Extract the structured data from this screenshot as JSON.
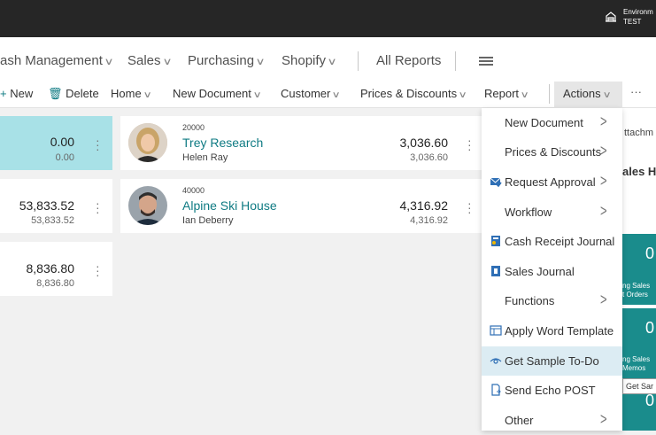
{
  "environment": {
    "line1": "Environm",
    "line2": "TEST"
  },
  "nav": {
    "cash_management": "ash Management",
    "sales": "Sales",
    "purchasing": "Purchasing",
    "shopify": "Shopify",
    "all_reports": "All Reports"
  },
  "actions": {
    "new": "New",
    "delete": "Delete",
    "home": "Home",
    "new_document": "New Document",
    "customer": "Customer",
    "prices_discounts": "Prices & Discounts",
    "report": "Report",
    "actions": "Actions",
    "more": "···"
  },
  "left_cards": [
    {
      "amount": "0.00",
      "sub": "0.00"
    },
    {
      "amount": "53,833.52",
      "sub": "53,833.52"
    },
    {
      "amount": "8,836.80",
      "sub": "8,836.80"
    }
  ],
  "customers": [
    {
      "no": "20000",
      "name": "Trey Research",
      "contact": "Helen Ray",
      "amount": "3,036.60",
      "sub": "3,036.60"
    },
    {
      "no": "40000",
      "name": "Alpine Ski House",
      "contact": "Ian Deberry",
      "amount": "4,316.92",
      "sub": "4,316.92"
    }
  ],
  "right_pane": {
    "attachments": "ttachm",
    "sales_history": "ales H",
    "tiles": [
      {
        "value": "0",
        "label1": "ng Sales",
        "label2": "t Orders"
      },
      {
        "value": "0",
        "label1": "ng Sales",
        "label2": "Memos"
      },
      {
        "value": "0",
        "label1": "",
        "label2": ""
      }
    ]
  },
  "menu": {
    "items": [
      {
        "label": "New Document",
        "submenu": true,
        "icon": ""
      },
      {
        "label": "Prices & Discounts",
        "submenu": true,
        "icon": ""
      },
      {
        "label": "Request Approval",
        "submenu": true,
        "icon": "approval-icon"
      },
      {
        "label": "Workflow",
        "submenu": true,
        "icon": ""
      },
      {
        "label": "Cash Receipt Journal",
        "submenu": false,
        "icon": "journal-icon"
      },
      {
        "label": "Sales Journal",
        "submenu": false,
        "icon": "book-icon"
      },
      {
        "label": "Functions",
        "submenu": true,
        "icon": ""
      },
      {
        "label": "Apply Word Template",
        "submenu": false,
        "icon": "word-template-icon"
      },
      {
        "label": "Get Sample To-Do",
        "submenu": false,
        "icon": "eye-icon"
      },
      {
        "label": "Send Echo POST",
        "submenu": false,
        "icon": "document-arrow-icon"
      },
      {
        "label": "Other",
        "submenu": true,
        "icon": ""
      }
    ]
  },
  "tooltip": "Get Sar",
  "colors": {
    "accent": "#0f7b83",
    "selected_card": "#a8e1e7",
    "tile": "#1a8c8c",
    "menu_hover": "#dcecf3"
  }
}
